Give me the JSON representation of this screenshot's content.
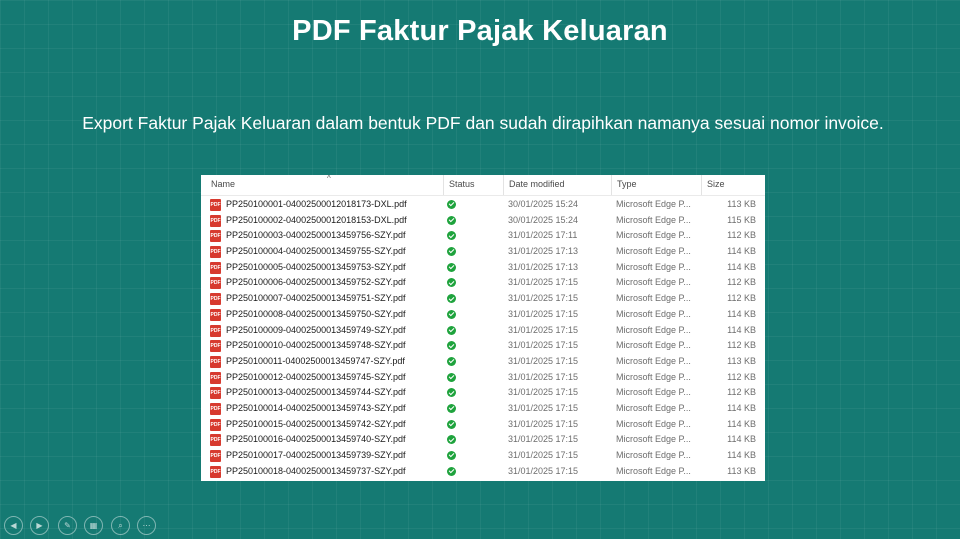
{
  "slide": {
    "title": "PDF Faktur Pajak Keluaran",
    "subtitle": "Export Faktur Pajak Keluaran dalam bentuk PDF dan sudah dirapihkan namanya sesuai nomor invoice."
  },
  "explorer": {
    "columns": {
      "name": "Name",
      "status": "Status",
      "date": "Date modified",
      "type": "Type",
      "size": "Size"
    },
    "sort_indicator": "^",
    "file_icon": "pdf-file-icon",
    "status_icon": "synced-check-icon",
    "files": [
      {
        "name": "PP250100001-04002500012018173-DXL.pdf",
        "date": "30/01/2025 15:24",
        "type": "Microsoft Edge P...",
        "size": "113 KB"
      },
      {
        "name": "PP250100002-04002500012018153-DXL.pdf",
        "date": "30/01/2025 15:24",
        "type": "Microsoft Edge P...",
        "size": "115 KB"
      },
      {
        "name": "PP250100003-04002500013459756-SZY.pdf",
        "date": "31/01/2025 17:11",
        "type": "Microsoft Edge P...",
        "size": "112 KB"
      },
      {
        "name": "PP250100004-04002500013459755-SZY.pdf",
        "date": "31/01/2025 17:13",
        "type": "Microsoft Edge P...",
        "size": "114 KB"
      },
      {
        "name": "PP250100005-04002500013459753-SZY.pdf",
        "date": "31/01/2025 17:13",
        "type": "Microsoft Edge P...",
        "size": "114 KB"
      },
      {
        "name": "PP250100006-04002500013459752-SZY.pdf",
        "date": "31/01/2025 17:15",
        "type": "Microsoft Edge P...",
        "size": "112 KB"
      },
      {
        "name": "PP250100007-04002500013459751-SZY.pdf",
        "date": "31/01/2025 17:15",
        "type": "Microsoft Edge P...",
        "size": "112 KB"
      },
      {
        "name": "PP250100008-04002500013459750-SZY.pdf",
        "date": "31/01/2025 17:15",
        "type": "Microsoft Edge P...",
        "size": "114 KB"
      },
      {
        "name": "PP250100009-04002500013459749-SZY.pdf",
        "date": "31/01/2025 17:15",
        "type": "Microsoft Edge P...",
        "size": "114 KB"
      },
      {
        "name": "PP250100010-04002500013459748-SZY.pdf",
        "date": "31/01/2025 17:15",
        "type": "Microsoft Edge P...",
        "size": "112 KB"
      },
      {
        "name": "PP250100011-04002500013459747-SZY.pdf",
        "date": "31/01/2025 17:15",
        "type": "Microsoft Edge P...",
        "size": "113 KB"
      },
      {
        "name": "PP250100012-04002500013459745-SZY.pdf",
        "date": "31/01/2025 17:15",
        "type": "Microsoft Edge P...",
        "size": "112 KB"
      },
      {
        "name": "PP250100013-04002500013459744-SZY.pdf",
        "date": "31/01/2025 17:15",
        "type": "Microsoft Edge P...",
        "size": "112 KB"
      },
      {
        "name": "PP250100014-04002500013459743-SZY.pdf",
        "date": "31/01/2025 17:15",
        "type": "Microsoft Edge P...",
        "size": "114 KB"
      },
      {
        "name": "PP250100015-04002500013459742-SZY.pdf",
        "date": "31/01/2025 17:15",
        "type": "Microsoft Edge P...",
        "size": "114 KB"
      },
      {
        "name": "PP250100016-04002500013459740-SZY.pdf",
        "date": "31/01/2025 17:15",
        "type": "Microsoft Edge P...",
        "size": "114 KB"
      },
      {
        "name": "PP250100017-04002500013459739-SZY.pdf",
        "date": "31/01/2025 17:15",
        "type": "Microsoft Edge P...",
        "size": "114 KB"
      },
      {
        "name": "PP250100018-04002500013459737-SZY.pdf",
        "date": "31/01/2025 17:15",
        "type": "Microsoft Edge P...",
        "size": "113 KB"
      }
    ]
  },
  "presenter_toolbar": [
    {
      "name": "previous-slide-icon",
      "glyph": "◀"
    },
    {
      "name": "next-slide-icon",
      "glyph": "▶"
    },
    {
      "name": "pen-icon",
      "glyph": "✎"
    },
    {
      "name": "slides-grid-icon",
      "glyph": "▦"
    },
    {
      "name": "zoom-icon",
      "glyph": "⌕"
    },
    {
      "name": "more-options-icon",
      "glyph": "⋯"
    }
  ],
  "colors": {
    "background": "#157a73",
    "pdf_icon": "#d73a2f",
    "status_ok": "#1fa33d"
  }
}
